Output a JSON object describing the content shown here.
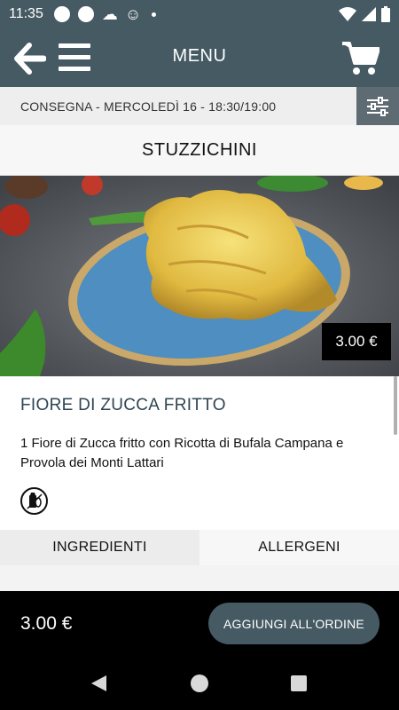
{
  "status_bar": {
    "time": "11:35",
    "icons": [
      "notification-dot-icon",
      "notification-dot-icon",
      "cloud-icon",
      "smiley-icon",
      "small-dot-icon",
      "wifi-icon",
      "signal-icon",
      "battery-icon"
    ]
  },
  "app_bar": {
    "title": "MENU",
    "left_icons": [
      "back-arrow-icon",
      "hamburger-menu-icon"
    ],
    "right_icons": [
      "cart-icon"
    ],
    "color": "#465a64"
  },
  "delivery": {
    "text": "CONSEGNA - MERCOLEDÌ 16 - 18:30/19:00",
    "filter_icon": "sliders-icon"
  },
  "section": {
    "title": "STUZZICHINI"
  },
  "product": {
    "image_subject": "fried zucchini flower on blue plate",
    "price": "3.00 €",
    "name": "FIORE DI ZUCCA FRITTO",
    "description": "1 Fiore di Zucca fritto con Ricotta di Bufala Campana e Provola dei Monti Lattari",
    "allergen_icon": "dairy-allergen-icon"
  },
  "tabs": [
    {
      "label": "INGREDIENTI",
      "active": true
    },
    {
      "label": "ALLERGENI",
      "active": false
    }
  ],
  "footer": {
    "total": "3.00 €",
    "add_button": "AGGIUNGI ALL'ORDINE"
  },
  "nav_bar": {
    "icons": [
      "nav-back-icon",
      "nav-home-icon",
      "nav-recents-icon"
    ]
  }
}
